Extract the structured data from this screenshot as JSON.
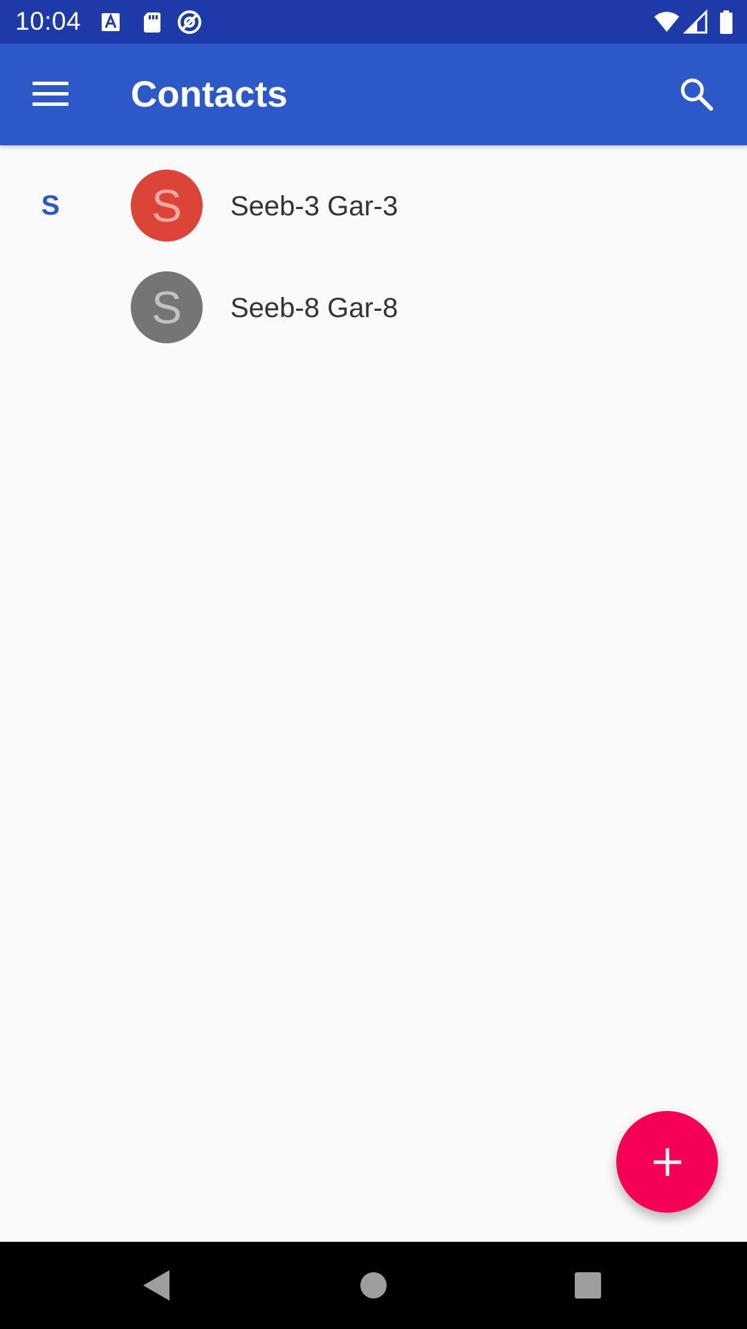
{
  "status_bar": {
    "time": "10:04",
    "icons": [
      "font-a-icon",
      "sd-card-icon",
      "at-sign-icon",
      "wifi-icon",
      "signal-icon",
      "battery-icon"
    ]
  },
  "app_bar": {
    "title": "Contacts",
    "menu_icon": "hamburger-menu-icon",
    "search_icon": "search-icon",
    "color": "#2c59c7"
  },
  "contacts": {
    "section_letter": "S",
    "items": [
      {
        "initial": "S",
        "name": "Seeb-3 Gar-3",
        "avatar_color": "#db4437"
      },
      {
        "initial": "S",
        "name": "Seeb-8 Gar-8",
        "avatar_color": "#757575"
      }
    ]
  },
  "fab": {
    "icon": "plus-icon",
    "color": "#f50057"
  },
  "nav_bar": {
    "icons": [
      "back-icon",
      "home-icon",
      "recents-icon"
    ]
  }
}
